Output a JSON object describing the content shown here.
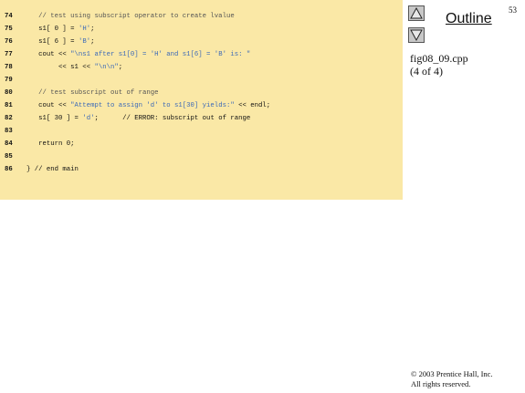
{
  "slide": {
    "page_number": "53",
    "outline_title": "Outline",
    "file_name": "fig08_09.cpp",
    "file_part": "(4 of 4)",
    "copyright_line1": "© 2003 Prentice Hall, Inc.",
    "copyright_line2": "All rights reserved.",
    "nav_up_icon": "triangle-up-icon",
    "nav_down_icon": "triangle-down-icon",
    "code_background": "#fae8a6",
    "string_color": "#3b69b8",
    "comment_color": "#555555"
  },
  "code_lines": [
    {
      "num": "74",
      "segments": [
        {
          "text": "   // test using subscript operator to create lvalue",
          "type": "comment"
        }
      ]
    },
    {
      "num": "75",
      "segments": [
        {
          "text": "   s1[ 0 ] = ",
          "type": "plain"
        },
        {
          "text": "'H'",
          "type": "string"
        },
        {
          "text": ";",
          "type": "plain"
        }
      ]
    },
    {
      "num": "76",
      "segments": [
        {
          "text": "   s1[ 6 ] = ",
          "type": "plain"
        },
        {
          "text": "'B'",
          "type": "string"
        },
        {
          "text": ";",
          "type": "plain"
        }
      ]
    },
    {
      "num": "77",
      "segments": [
        {
          "text": "   cout << ",
          "type": "plain"
        },
        {
          "text": "\"\\ns1 after s1[0] = 'H' and s1[6] = 'B' is: \"",
          "type": "string"
        }
      ]
    },
    {
      "num": "78",
      "segments": [
        {
          "text": "        << s1 << ",
          "type": "plain"
        },
        {
          "text": "\"\\n\\n\"",
          "type": "string"
        },
        {
          "text": ";",
          "type": "plain"
        }
      ]
    },
    {
      "num": "79",
      "segments": []
    },
    {
      "num": "80",
      "segments": [
        {
          "text": "   // test subscript out of range",
          "type": "comment"
        }
      ]
    },
    {
      "num": "81",
      "segments": [
        {
          "text": "   cout << ",
          "type": "plain"
        },
        {
          "text": "\"Attempt to assign 'd' to s1[30] yields:\"",
          "type": "string"
        },
        {
          "text": " << endl;",
          "type": "plain"
        }
      ]
    },
    {
      "num": "82",
      "segments": [
        {
          "text": "   s1[ 30 ] = ",
          "type": "plain"
        },
        {
          "text": "'d'",
          "type": "string"
        },
        {
          "text": ";      // ERROR: subscript out of range",
          "type": "plain"
        }
      ]
    },
    {
      "num": "83",
      "segments": []
    },
    {
      "num": "84",
      "segments": [
        {
          "text": "   return 0;",
          "type": "plain"
        }
      ]
    },
    {
      "num": "85",
      "segments": []
    },
    {
      "num": "86",
      "segments": [
        {
          "text": "} // end main",
          "type": "plain"
        }
      ]
    }
  ]
}
